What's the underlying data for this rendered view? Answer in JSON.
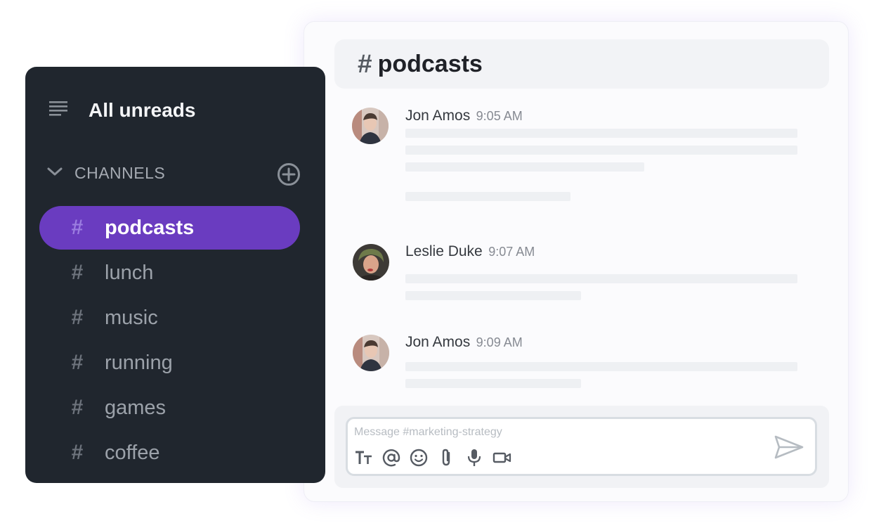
{
  "sidebar": {
    "unreads_label": "All unreads",
    "unreads_icon": "list-lines-icon",
    "channels_header": "CHANNELS",
    "collapse_icon": "chevron-down-icon",
    "add_icon": "plus-circle-icon",
    "channels": [
      {
        "hash": "#",
        "name": "podcasts",
        "active": true
      },
      {
        "hash": "#",
        "name": "lunch",
        "active": false
      },
      {
        "hash": "#",
        "name": "music",
        "active": false
      },
      {
        "hash": "#",
        "name": "running",
        "active": false
      },
      {
        "hash": "#",
        "name": "games",
        "active": false
      },
      {
        "hash": "#",
        "name": "coffee",
        "active": false
      }
    ]
  },
  "chat": {
    "hash": "#",
    "title": "podcasts",
    "messages": [
      {
        "author": "Jon Amos",
        "time": "9:05 AM"
      },
      {
        "author": "Leslie Duke",
        "time": "9:07 AM"
      },
      {
        "author": "Jon Amos",
        "time": "9:09 AM"
      }
    ],
    "composer": {
      "placeholder": "Message #marketing-strategy",
      "tools": [
        "text-format-icon",
        "mention-icon",
        "emoji-icon",
        "attachment-icon",
        "microphone-icon",
        "video-icon"
      ],
      "send_icon": "send-icon"
    }
  },
  "colors": {
    "sidebar_bg": "#20262e",
    "active_channel": "#6a3cc0",
    "chat_bg": "#fbfbfd"
  }
}
